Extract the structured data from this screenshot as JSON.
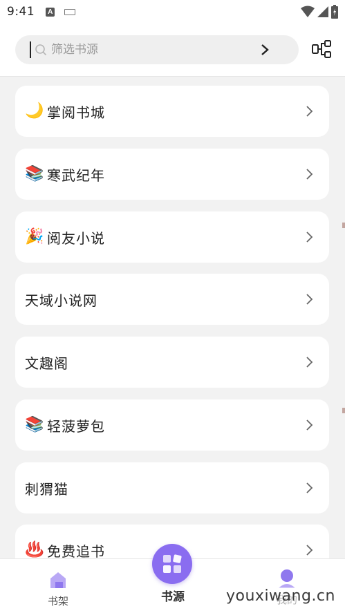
{
  "status_bar": {
    "time": "9:41"
  },
  "search": {
    "placeholder": "筛选书源",
    "value": ""
  },
  "sources": [
    {
      "emoji": "🌙",
      "title": "掌阅书城"
    },
    {
      "emoji": "📚",
      "title": "寒武纪年"
    },
    {
      "emoji": "🎉",
      "title": "阅友小说"
    },
    {
      "emoji": "",
      "title": "天域小说网"
    },
    {
      "emoji": "",
      "title": "文趣阁"
    },
    {
      "emoji": "📚",
      "title": "轻菠萝包"
    },
    {
      "emoji": "",
      "title": "刺猬猫"
    },
    {
      "emoji": "♨️",
      "title": "免费追书"
    }
  ],
  "tabs": {
    "shelf": "书架",
    "source": "书源",
    "me": "我的"
  },
  "watermark": "youxiwang.cn",
  "colors": {
    "accent": "#8a6df0",
    "background": "#f2f2f2",
    "card": "#ffffff"
  }
}
